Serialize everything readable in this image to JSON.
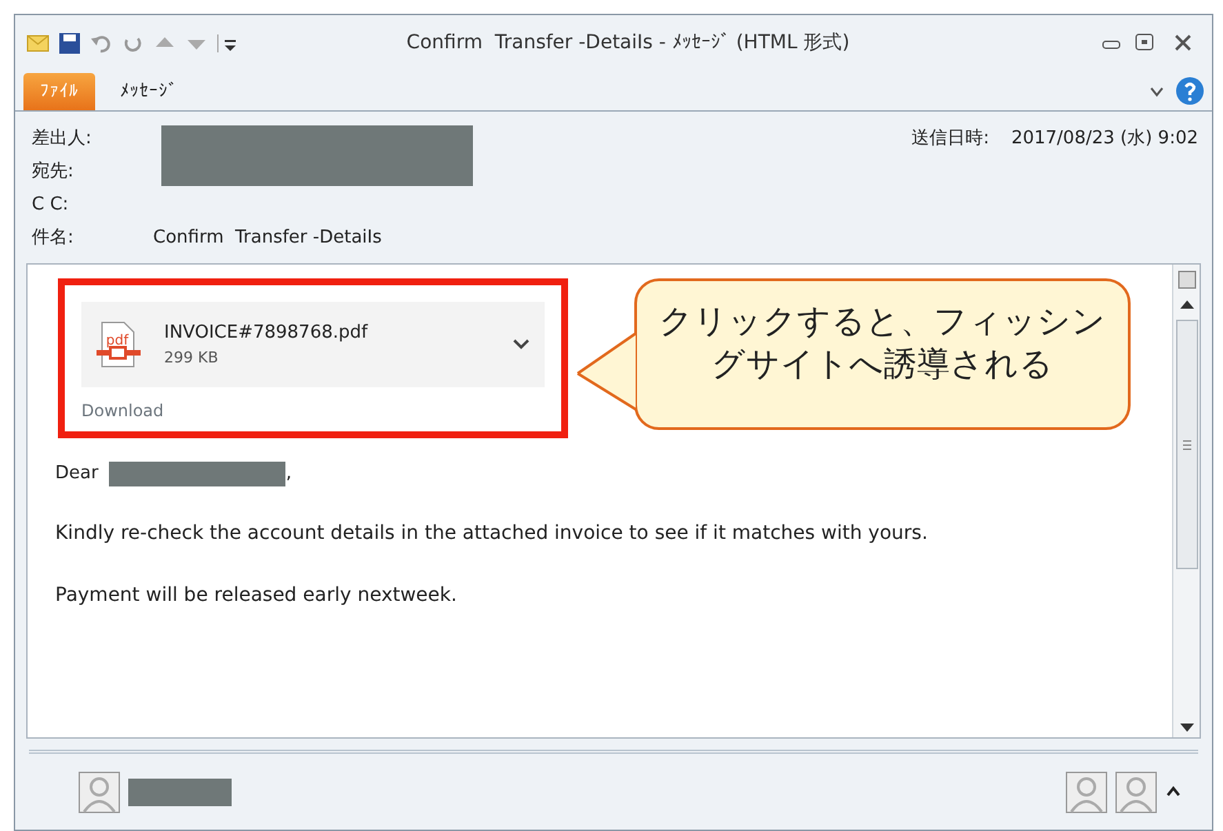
{
  "window": {
    "title": "Confirm  Transfer -DetaiIs - ﾒｯｾｰｼﾞ (HTML 形式)"
  },
  "tabs": [
    {
      "label": "ﾌｧｲﾙ",
      "kind": "file"
    },
    {
      "label": "ﾒｯｾｰｼﾞ",
      "kind": "tab"
    }
  ],
  "header": {
    "fields": [
      {
        "label": "差出人:"
      },
      {
        "label": "宛先:"
      },
      {
        "label": "C C:"
      },
      {
        "label": "件名:",
        "value": "Confirm  Transfer -DetaiIs"
      }
    ],
    "sent_label": "送信日時:",
    "sent_value": "2017/08/23 (水) 9:02"
  },
  "attachment": {
    "name": "INVOICE#7898768.pdf",
    "size": "299 KB",
    "icon_label": "pdf",
    "action": "Download"
  },
  "callout": {
    "lines": [
      "クリックすると、フィッシン",
      "グサイトへ誘導される"
    ]
  },
  "body": {
    "greeting": "Dear",
    "greeting_end": ",",
    "paragraphs": [
      "Kindly re-check the account details in the attached invoice to see if it matches with yours.",
      "Payment will be released early nextweek."
    ]
  }
}
